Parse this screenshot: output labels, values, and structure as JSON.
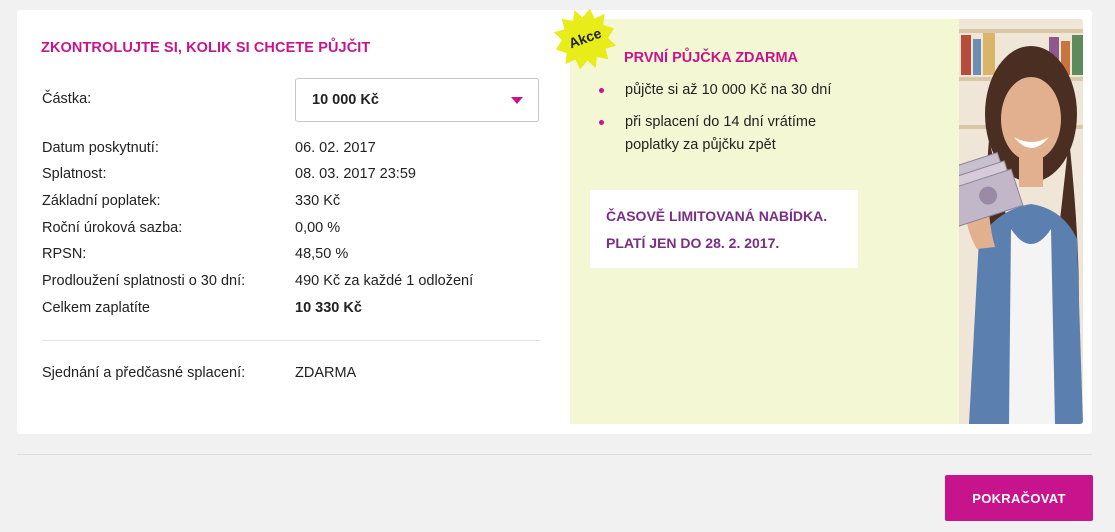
{
  "calculator": {
    "title": "ZKONTROLUJTE SI, KOLIK SI CHCETE PŮJČIT",
    "amount_label": "Částka:",
    "amount_value": "10 000 Kč",
    "rows": [
      {
        "label": "Datum poskytnutí:",
        "value": "06. 02. 2017"
      },
      {
        "label": "Splatnost:",
        "value": "08. 03. 2017 23:59"
      },
      {
        "label": "Základní poplatek:",
        "value": "330 Kč"
      },
      {
        "label": "Roční úroková sazba:",
        "value": "0,00 %"
      },
      {
        "label": "RPSN:",
        "value": "48,50 %"
      },
      {
        "label": "Prodloužení splatnosti o 30 dní:",
        "value": "490 Kč za každé 1 odložení"
      },
      {
        "label": "Celkem zaplatíte",
        "value": "10 330 Kč"
      }
    ],
    "extra_label": "Sjednání a předčasné splacení:",
    "extra_value": "ZDARMA"
  },
  "promo": {
    "badge": "Akce",
    "title": "PRVNÍ PŮJČKA ZDARMA",
    "bullets": [
      "půjčte si až 10 000 Kč na 30 dní",
      "při splacení do 14 dní vrátíme poplatky za půjčku zpět"
    ],
    "offer_line1": "ČASOVĚ LIMITOVANÁ NABÍDKA.",
    "offer_line2": "PLATÍ JEN DO 28. 2. 2017."
  },
  "footer": {
    "continue_label": "POKRAČOVAT"
  },
  "colors": {
    "accent": "#c8148c",
    "promo_bg": "#f4f7d4",
    "offer_text": "#7b2d86",
    "badge": "#e8ec19"
  }
}
